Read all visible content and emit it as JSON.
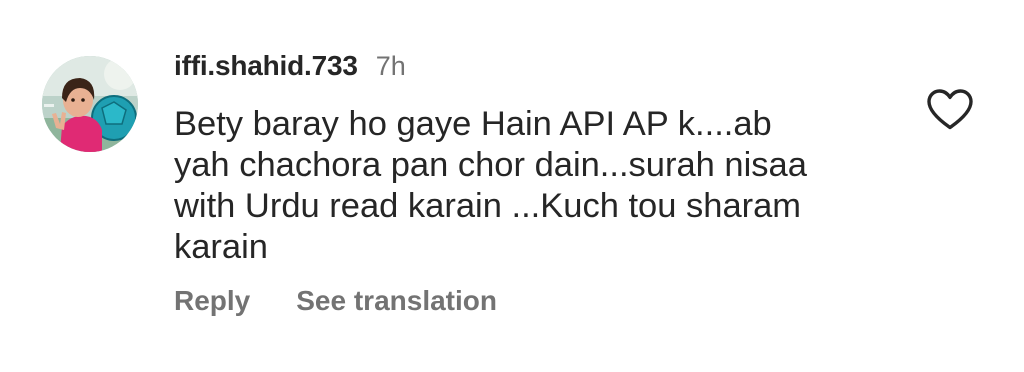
{
  "comment": {
    "username": "iffi.shahid.733",
    "time": "7h",
    "text": "Bety baray ho gaye Hain API AP k....ab\nyah chachora pan chor dain...surah nisaa\nwith Urdu read karain ...Kuch tou sharam\nkarain",
    "actions": {
      "reply": "Reply",
      "see_translation": "See translation"
    },
    "like_icon": "heart-outline-icon",
    "avatar_icon": "profile-photo"
  },
  "colors": {
    "text_primary": "#262626",
    "text_secondary": "#737373",
    "background": "#ffffff"
  }
}
